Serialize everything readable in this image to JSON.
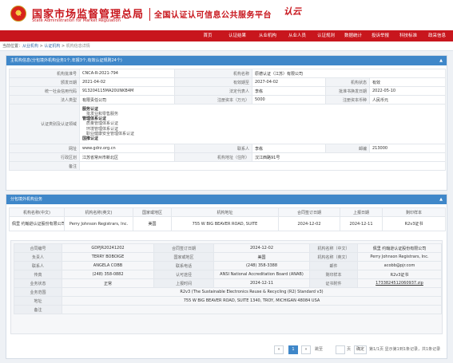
{
  "header": {
    "org_cn": "国家市场监督管理总局",
    "org_en": "State Administration for Market Regulation",
    "platform": "全国认证认可信息公共服务平台",
    "logo_text": "认云"
  },
  "nav": [
    "首页",
    "认证结果",
    "从业机构",
    "从业人员",
    "认证规则",
    "数据统计",
    "投诉举报",
    "科技标准",
    "政采信息"
  ],
  "breadcrumb": {
    "prefix": "当前位置：",
    "items": [
      "从业机构",
      "认证机构",
      "机构信息详情"
    ],
    "sep": " > "
  },
  "main_title": "主机构信息(分包境外机构业务1个,年报3个,有效认证规则24个)",
  "info": {
    "approval_no_label": "机构批准号",
    "approval_no": "CNCA-R-2021-794",
    "name_label": "机构名称",
    "name": "原德认证（江苏）有限公司",
    "issue_date_label": "颁发日期",
    "issue_date": "2021-04-02",
    "valid_until_label": "有效期至",
    "valid_until": "2027-04-02",
    "status_label": "机构状态",
    "status": "有效",
    "credit_code_label": "统一社会信用代码",
    "credit_code": "913204115MA20UNKB4M",
    "legal_rep_label": "法定代表人",
    "legal_rep": "李栋",
    "change_date_label": "批准书换发日期",
    "change_date": "2022-05-10",
    "legal_type_label": "法人类型",
    "legal_type": "有限责任公司",
    "capital_label": "注册资本（万元）",
    "capital": "5000",
    "currency_label": "注册资本币种",
    "currency": "人民币元",
    "scope_label": "认证类别及认证领域",
    "scope": [
      {
        "t": "h",
        "text": "服务认证"
      },
      {
        "t": "s",
        "text": "批发业和零售服务"
      },
      {
        "t": "h",
        "text": "管理体系认证"
      },
      {
        "t": "s",
        "text": "质量管理体系认证"
      },
      {
        "t": "s",
        "text": "环境管理体系认证"
      },
      {
        "t": "s",
        "text": "职业健康安全管理体系认证"
      },
      {
        "t": "h",
        "text": "国推认证"
      }
    ],
    "website_label": "网址",
    "website": "www.gdrz.org.cn",
    "contact_label": "联系人",
    "contact": "李栋",
    "postcode_label": "邮编",
    "postcode": "213000",
    "region_label": "行政区划",
    "region": "江苏省常州市新北区",
    "address_label": "机构地址（住所）",
    "address": "汉江西路91号",
    "remark_label": "备注",
    "remark": ""
  },
  "sub_title": "分包境外机构业务",
  "sub_table": {
    "headers": [
      "机构名称(中文)",
      "机构名称(英文)",
      "国家或地区",
      "机构地址",
      "合同签订日期",
      "上报日期",
      "剩印样本"
    ],
    "rows": [
      [
        "佩里 约翰逊认证股份有限公司",
        "Perry Johnson Registrars, Inc.",
        "美国",
        "755 W BIG BEAVER ROAD, SUITE",
        "2024-12-02",
        "2024-12-11",
        "R2v3证书"
      ]
    ]
  },
  "detail": {
    "contract_no_label": "合同编号",
    "contract_no": "GDPJR20241202",
    "sign_date_label": "合同签订日期",
    "sign_date": "2024-12-02",
    "name_cn_label": "机构名称（中文）",
    "name_cn": "佩里 约翰逊认证股份有限公司",
    "manager_label": "负责人",
    "manager": "TERRY BOBOIGE",
    "country_label": "国家或地区",
    "country": "美国",
    "name_en_label": "机构名称（英文）",
    "name_en": "Perry Johnson Registrars, Inc.",
    "contact_label": "联系人",
    "contact": "ANGELA COBB",
    "phone_label": "联系电话",
    "phone": "(248) 358-3388",
    "email_label": "邮件",
    "email": "acobb@pjr.com",
    "fax_label": "传真",
    "fax": "(248) 358-0882",
    "accred_label": "认可途径",
    "accred": "ANSI National Accreditation Board (ANAB)",
    "sample_label": "剩印样本",
    "sample": "R2v3证书",
    "biz_status_label": "业务状态",
    "biz_status": "正常",
    "report_date_label": "上报时间",
    "report_date": "2024-12-11",
    "cert_file_label": "证书附件",
    "cert_file": "1733824512060937.zip",
    "scope_label": "业务范围",
    "scope": "R2v3 (The Sustainable Electronics Reuse & Recycling (R2) Standard v3)",
    "address_label": "地址",
    "address": "755 W BIG BEAVER ROAD, SUITE 1340, TROY, MICHIGAN 48084 USA",
    "remark_label": "备注",
    "remark": ""
  },
  "pagination": {
    "page": "1",
    "jump_to": "跳至",
    "page_unit": "页",
    "confirm": "确定",
    "total": "第1/1页 显示第1到1条记录，共1条记录"
  }
}
